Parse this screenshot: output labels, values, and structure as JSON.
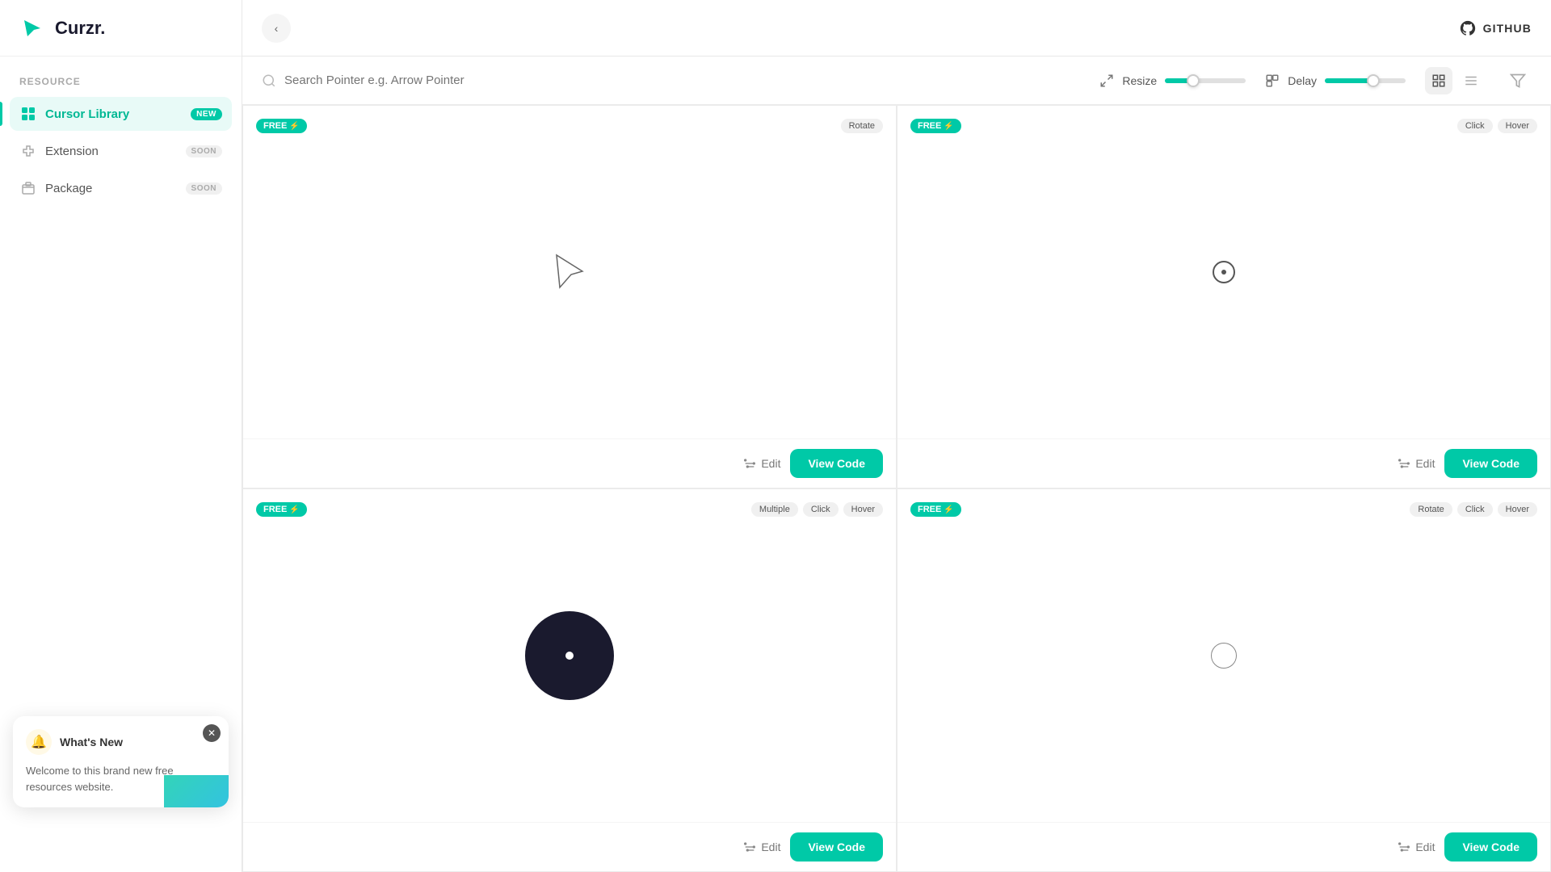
{
  "app": {
    "name": "Curzr.",
    "logo_color": "#00c9a7"
  },
  "header": {
    "github_label": "GITHUB",
    "collapse_icon": "‹"
  },
  "sidebar": {
    "section_label": "Resource",
    "items": [
      {
        "id": "cursor-library",
        "label": "Cursor Library",
        "badge": "NEW",
        "badge_type": "new",
        "active": true
      },
      {
        "id": "extension",
        "label": "Extension",
        "badge": "SOON",
        "badge_type": "soon",
        "active": false
      },
      {
        "id": "package",
        "label": "Package",
        "badge": "SOON",
        "badge_type": "soon",
        "active": false
      }
    ]
  },
  "search": {
    "placeholder": "Search Pointer e.g. Arrow Pointer",
    "value": ""
  },
  "controls": {
    "resize_label": "Resize",
    "resize_value": 35,
    "delay_label": "Delay",
    "delay_value": 60
  },
  "cursors": [
    {
      "id": "card-1",
      "free": true,
      "tags": [
        "Rotate"
      ],
      "preview_type": "arrow",
      "edit_label": "Edit",
      "view_code_label": "View Code"
    },
    {
      "id": "card-2",
      "free": true,
      "tags": [
        "Click",
        "Hover"
      ],
      "preview_type": "dot-outline",
      "edit_label": "Edit",
      "view_code_label": "View Code"
    },
    {
      "id": "card-3",
      "free": true,
      "tags": [
        "Multiple",
        "Click",
        "Hover"
      ],
      "preview_type": "blob",
      "edit_label": "Edit",
      "view_code_label": "View Code"
    },
    {
      "id": "card-4",
      "free": true,
      "tags": [
        "Rotate",
        "Click",
        "Hover"
      ],
      "preview_type": "circle-empty",
      "edit_label": "Edit",
      "view_code_label": "View Code"
    }
  ],
  "notification": {
    "title": "What's New",
    "body": "Welcome to this brand new free resources website.",
    "bell_icon": "🔔",
    "close_icon": "✕"
  },
  "icons": {
    "search": "🔍",
    "filter": "⚗",
    "grid_view": "⊞",
    "list_view": "☰",
    "github": "◉",
    "resize": "⤢",
    "delay": "⏱",
    "edit": "⚙"
  }
}
